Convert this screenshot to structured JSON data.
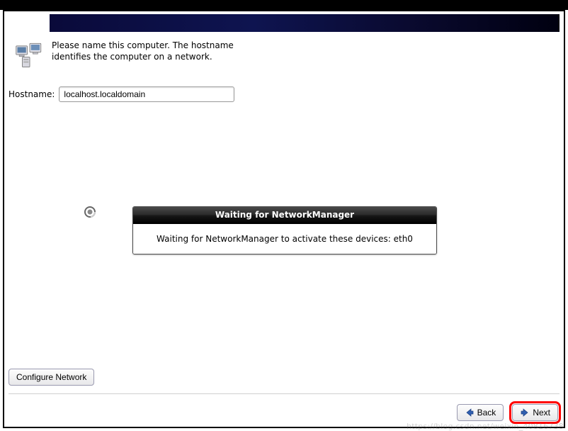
{
  "header": {
    "banner_color_start": "#0a0a3a",
    "banner_color_end": "#000010"
  },
  "intro": {
    "text": "Please name this computer.  The hostname identifies the computer on a network."
  },
  "hostname": {
    "label": "Hostname:",
    "value": "localhost.localdomain",
    "placeholder": ""
  },
  "dialog": {
    "title": "Waiting for NetworkManager",
    "body": "Waiting for NetworkManager to activate these devices: eth0"
  },
  "buttons": {
    "configure_network": "Configure Network",
    "back": "Back",
    "next": "Next"
  },
  "watermark": "https://blog.csdn.net/weixin_40816738"
}
